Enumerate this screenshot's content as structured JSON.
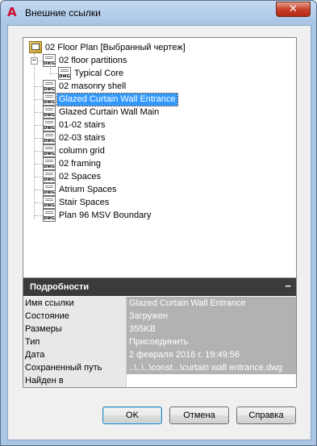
{
  "window": {
    "title": "Внешние ссылки",
    "close_glyph": "✕",
    "app_glyph": "A"
  },
  "tree": {
    "root_label": "02 Floor Plan [Выбранный чертеж]",
    "expander_glyph": "−",
    "file_icon_text": "DWG",
    "items": [
      {
        "label": "02 floor partitions",
        "level": 1,
        "expanded": true
      },
      {
        "label": "Typical Core",
        "level": 2
      },
      {
        "label": "02 masonry shell",
        "level": 1
      },
      {
        "label": "Glazed Curtain Wall Entrance",
        "level": 1,
        "selected": true
      },
      {
        "label": "Glazed Curtain Wall Main",
        "level": 1
      },
      {
        "label": "01-02 stairs",
        "level": 1
      },
      {
        "label": "02-03 stairs",
        "level": 1
      },
      {
        "label": "column grid",
        "level": 1
      },
      {
        "label": "02 framing",
        "level": 1
      },
      {
        "label": "02 Spaces",
        "level": 1
      },
      {
        "label": "Atrium Spaces",
        "level": 1
      },
      {
        "label": "Stair Spaces",
        "level": 1
      },
      {
        "label": "Plan 96 MSV Boundary",
        "level": 1
      }
    ]
  },
  "details": {
    "header": "Подробности",
    "collapse_glyph": "−",
    "rows": [
      {
        "name": "Имя ссылки",
        "value": "Glazed Curtain Wall Entrance"
      },
      {
        "name": "Состояние",
        "value": "Загружен"
      },
      {
        "name": "Размеры",
        "value": "355KB"
      },
      {
        "name": "Тип",
        "value": "Присоединить"
      },
      {
        "name": "Дата",
        "value": "2 февраля 2016 г.  19:49:56"
      },
      {
        "name": "Сохраненный путь",
        "value": "..\\..\\..\\const...\\curtain wall entrance.dwg"
      },
      {
        "name": "Найден в",
        "value": ""
      }
    ]
  },
  "buttons": {
    "ok": "OK",
    "cancel": "Отмена",
    "help": "Справка"
  }
}
